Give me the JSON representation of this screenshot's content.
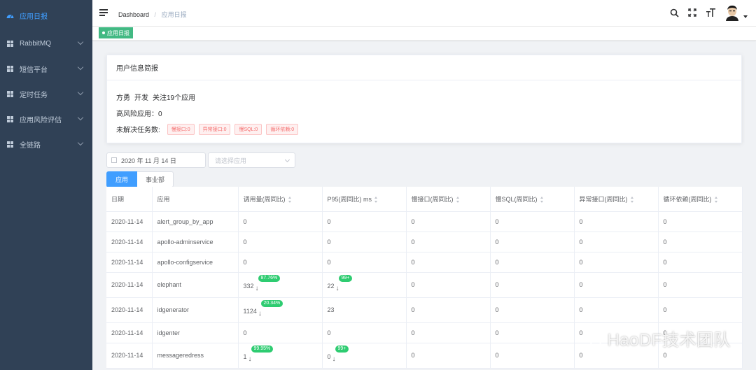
{
  "sidebar": {
    "items": [
      {
        "label": "应用日报",
        "active": true
      },
      {
        "label": "RabbitMQ"
      },
      {
        "label": "短信平台"
      },
      {
        "label": "定时任务"
      },
      {
        "label": "应用风险评估"
      },
      {
        "label": "全链路"
      }
    ]
  },
  "header": {
    "breadcrumb_root": "Dashboard",
    "breadcrumb_sep": "/",
    "breadcrumb_current": "应用日报"
  },
  "tags": {
    "active": "应用日报"
  },
  "card": {
    "title": "用户信息简报",
    "user_name": "方勇",
    "user_role": "开发",
    "user_follow": "关注19个应用",
    "high_risk": "高风险应用：0",
    "unresolved_label": "未解决任务数:",
    "badges": [
      "慢接口:0",
      "异常接口:0",
      "慢SQL:0",
      "循环依赖:0"
    ]
  },
  "filters": {
    "date": "2020 年 11 月 14 日",
    "app_placeholder": "请选择应用",
    "seg_app": "应用",
    "seg_dept": "事业部"
  },
  "table": {
    "headers": [
      "日期",
      "应用",
      "调用量(周同比)",
      "P95(周同比) ms",
      "慢接口(周同比)",
      "慢SQL(周同比)",
      "异常接口(周同比)",
      "循环依赖(周同比)"
    ],
    "rows": [
      {
        "date": "2020-11-14",
        "app": "alert_group_by_app",
        "calls": "0",
        "calls_pill": "",
        "p95": "0",
        "p95_pill": "",
        "slow_api": "0",
        "slow_sql": "0",
        "err_api": "0",
        "cycle": "0"
      },
      {
        "date": "2020-11-14",
        "app": "apollo-adminservice",
        "calls": "0",
        "calls_pill": "",
        "p95": "0",
        "p95_pill": "",
        "slow_api": "0",
        "slow_sql": "0",
        "err_api": "0",
        "cycle": "0"
      },
      {
        "date": "2020-11-14",
        "app": "apollo-configservice",
        "calls": "0",
        "calls_pill": "",
        "p95": "0",
        "p95_pill": "",
        "slow_api": "0",
        "slow_sql": "0",
        "err_api": "0",
        "cycle": "0"
      },
      {
        "date": "2020-11-14",
        "app": "elephant",
        "calls": "332",
        "calls_pill": "87.76%",
        "p95": "22",
        "p95_pill": "99+",
        "slow_api": "0",
        "slow_sql": "0",
        "err_api": "0",
        "cycle": "0"
      },
      {
        "date": "2020-11-14",
        "app": "idgenerator",
        "calls": "1124",
        "calls_pill": "20.34%",
        "p95": "23",
        "p95_pill": "",
        "slow_api": "0",
        "slow_sql": "0",
        "err_api": "0",
        "cycle": "0"
      },
      {
        "date": "2020-11-14",
        "app": "idgenter",
        "calls": "0",
        "calls_pill": "",
        "p95": "0",
        "p95_pill": "",
        "slow_api": "0",
        "slow_sql": "0",
        "err_api": "0",
        "cycle": "0"
      },
      {
        "date": "2020-11-14",
        "app": "messageredress",
        "calls": "1",
        "calls_pill": "99.95%",
        "p95": "0",
        "p95_pill": "99+",
        "slow_api": "0",
        "slow_sql": "0",
        "err_api": "0",
        "cycle": "0"
      }
    ]
  },
  "watermark": "HaoDF技术团队",
  "colors": {
    "sidebar_bg": "#304156",
    "accent": "#409eff",
    "tag_green": "#42b983",
    "pill_green": "#2ecc71",
    "badge_red": "#f56c6c"
  }
}
